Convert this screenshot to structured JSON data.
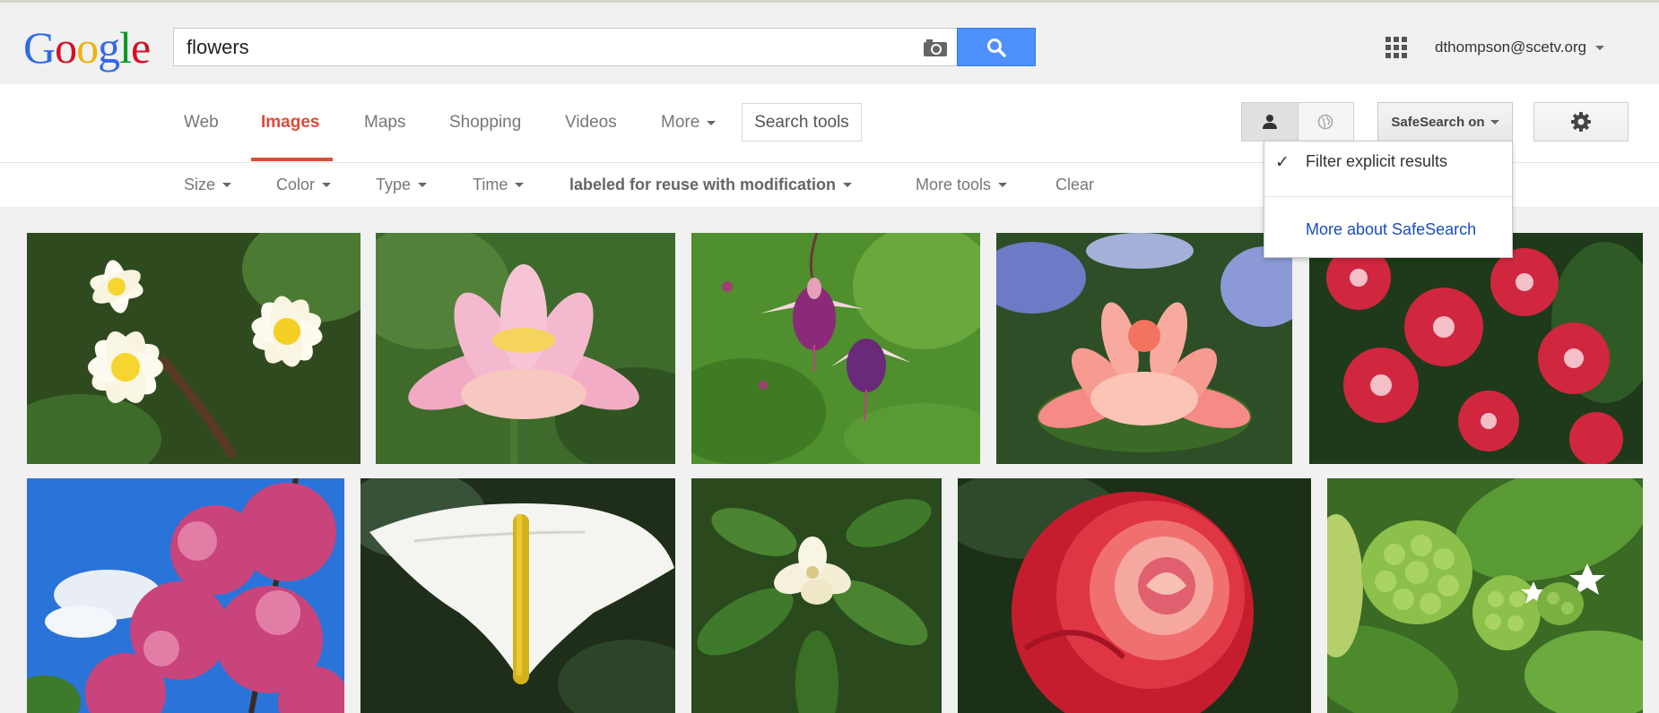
{
  "header": {
    "logo_letters": [
      {
        "ch": "G",
        "color": "#3369e8"
      },
      {
        "ch": "o",
        "color": "#d50f25"
      },
      {
        "ch": "o",
        "color": "#eeb211"
      },
      {
        "ch": "g",
        "color": "#3369e8"
      },
      {
        "ch": "l",
        "color": "#009925"
      },
      {
        "ch": "e",
        "color": "#d50f25"
      }
    ],
    "search_value": "flowers",
    "account": "dthompson@scetv.org"
  },
  "nav": {
    "items": [
      "Web",
      "Images",
      "Maps",
      "Shopping",
      "Videos",
      "More"
    ],
    "active": "Images",
    "search_tools": "Search tools",
    "safesearch": "SafeSearch on"
  },
  "tools": {
    "items": [
      "Size",
      "Color",
      "Type",
      "Time",
      "labeled for reuse with modification",
      "More tools"
    ],
    "clear": "Clear"
  },
  "dropdown": {
    "filter_label": "Filter explicit results",
    "more_link": "More about SafeSearch"
  },
  "colors": {
    "accent_red": "#dd4b39",
    "search_blue": "#4d90fe",
    "link_blue": "#1a4dbe"
  },
  "images": [
    {
      "subject": "plumeria"
    },
    {
      "subject": "lotus"
    },
    {
      "subject": "fuchsia"
    },
    {
      "subject": "pink-water-lily"
    },
    {
      "subject": "dianthus"
    },
    {
      "subject": "cherry-blossom"
    },
    {
      "subject": "calla-lily"
    },
    {
      "subject": "magnolia"
    },
    {
      "subject": "red-rose"
    },
    {
      "subject": "noni-fruit"
    }
  ]
}
